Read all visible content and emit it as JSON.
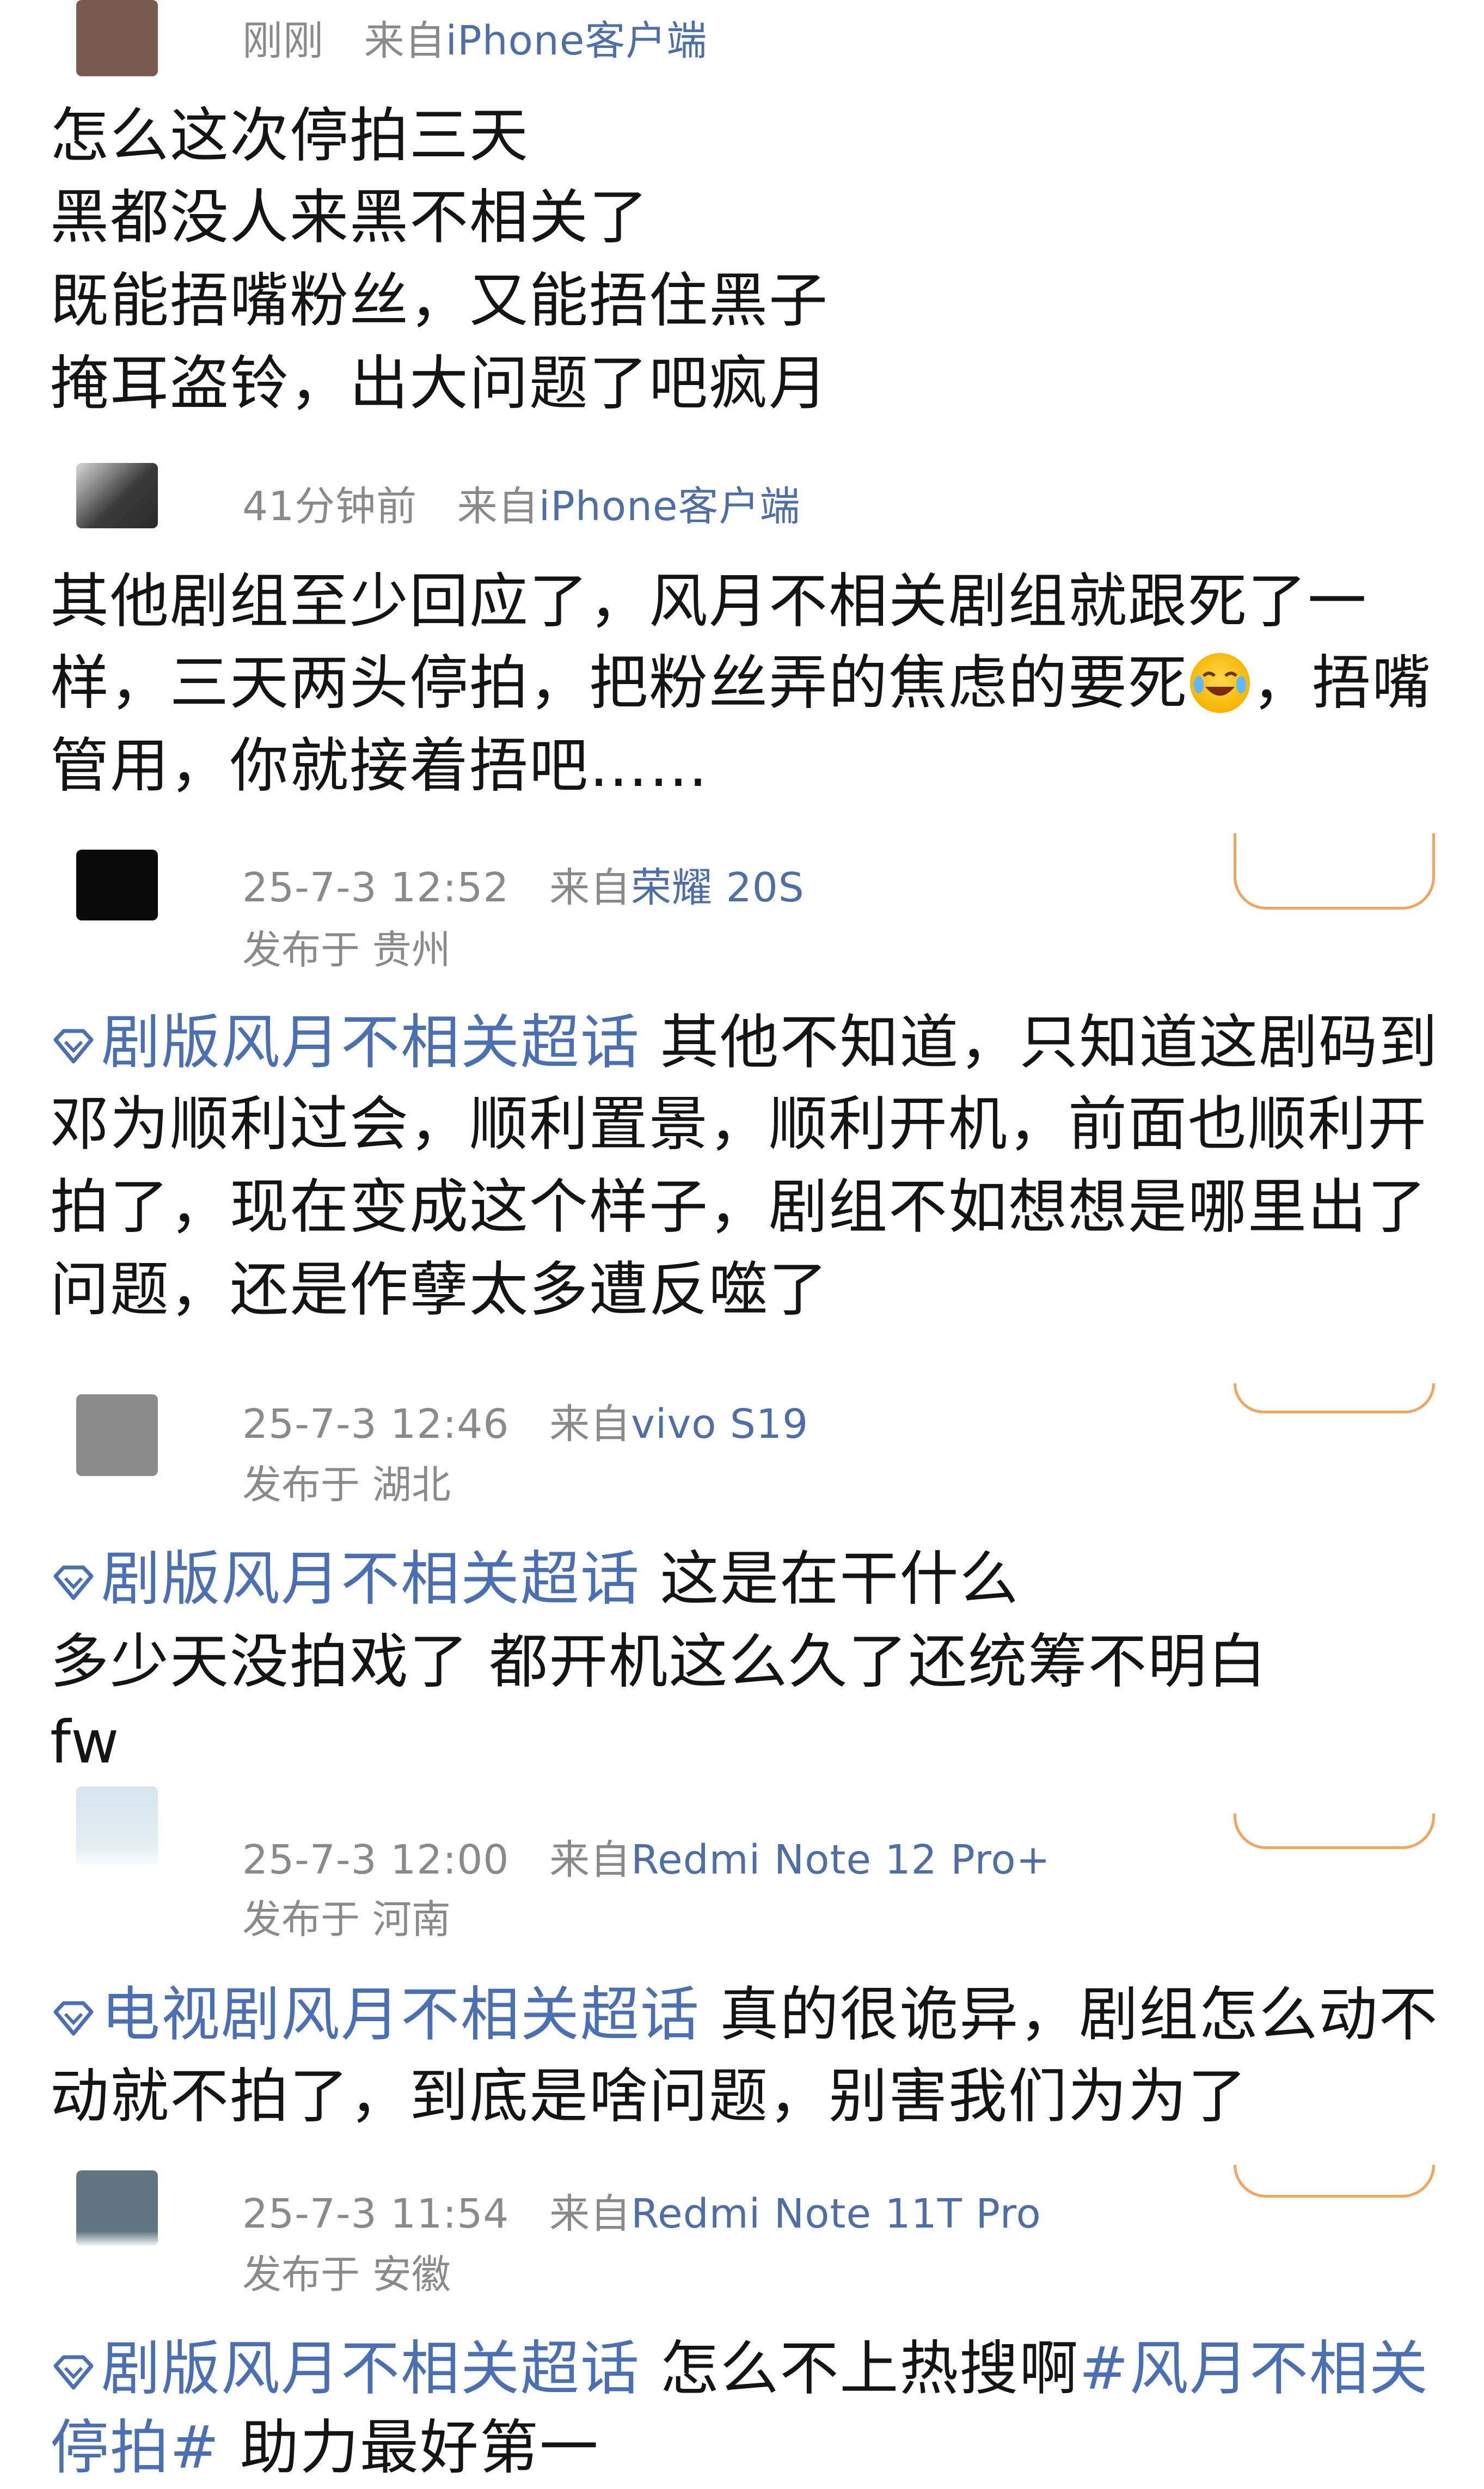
{
  "posts": [
    {
      "time": "刚刚",
      "from_label": "来自",
      "source": "iPhone客户端",
      "location": "",
      "lines": [
        "怎么这次停拍三天",
        "黑都没人来黑不相关了",
        "既能捂嘴粉丝，又能捂住黑子",
        "掩耳盗铃，出大问题了吧疯月"
      ]
    },
    {
      "time": "41分钟前",
      "from_label": "来自",
      "source": "iPhone客户端",
      "location": "",
      "lines": [
        "其他剧组至少回应了，风月不相关剧组就跟死了一",
        "样，三天两头停拍，把粉丝弄的焦虑的要死",
        "，捂嘴",
        "管用，你就接着捂吧……"
      ],
      "emoji": "crying-laughing-emoji"
    },
    {
      "time": "25-7-3 12:52",
      "from_label": "来自",
      "source": "荣耀 20S",
      "location": "发布于 贵州",
      "topic": "剧版风月不相关超话",
      "lines": [
        "其他不知道，只知道这剧码到",
        "邓为顺利过会，顺利置景，顺利开机，前面也顺利开",
        "拍了，现在变成这个样子，剧组不如想想是哪里出了",
        "问题，还是作孽太多遭反噬了"
      ]
    },
    {
      "time": "25-7-3 12:46",
      "from_label": "来自",
      "source": "vivo S19",
      "location": "发布于 湖北",
      "topic": "剧版风月不相关超话",
      "lines": [
        "这是在干什么",
        "多少天没拍戏了 都开机这么久了还统筹不明白",
        "fw"
      ]
    },
    {
      "time": "25-7-3 12:00",
      "from_label": "来自",
      "source": "Redmi Note 12 Pro+",
      "location": "发布于 河南",
      "topic": "电视剧风月不相关超话",
      "lines": [
        "真的很诡异，剧组怎么动不",
        "动就不拍了，到底是啥问题，别害我们为为了"
      ]
    },
    {
      "time": "25-7-3 11:54",
      "from_label": "来自",
      "source": "Redmi Note 11T Pro",
      "location": "发布于 安徽",
      "topic": "剧版风月不相关超话",
      "lines": [
        "怎么不上热搜啊",
        "助力最好第一"
      ],
      "hashtag_a": "#风月不相关",
      "hashtag_b": "停拍#"
    }
  ],
  "colors": {
    "link": "#4e6ea8",
    "topic": "#4a6fb3",
    "meta": "#8a8a8a",
    "follow_border": "#f2a45f"
  }
}
